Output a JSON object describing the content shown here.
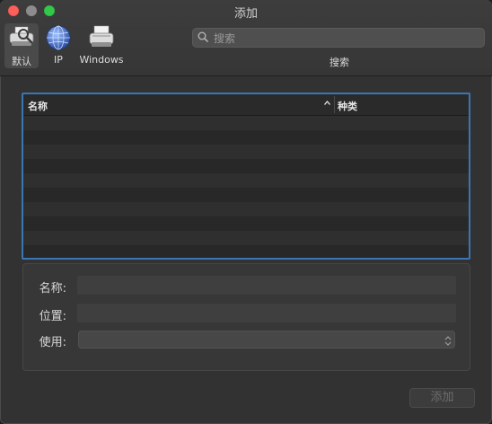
{
  "window": {
    "title": "添加"
  },
  "toolbar": {
    "items": [
      {
        "label": "默认",
        "icon": "default-printer-icon",
        "active": true
      },
      {
        "label": "IP",
        "icon": "globe-network-icon",
        "active": false
      },
      {
        "label": "Windows",
        "icon": "windows-printer-icon",
        "active": false
      }
    ],
    "search": {
      "placeholder": "搜索",
      "value": "",
      "label": "搜索"
    }
  },
  "printer_list": {
    "columns": {
      "name": "名称",
      "type": "种类"
    },
    "sort": "ascending-by-name",
    "rows": []
  },
  "details": {
    "name_label": "名称:",
    "location_label": "位置:",
    "use_label": "使用:",
    "name_value": "",
    "location_value": "",
    "use_value": ""
  },
  "actions": {
    "add_label": "添加",
    "add_enabled": false
  },
  "colors": {
    "accent": "#3b76b4",
    "close": "#fc605c",
    "maximize": "#34c84a"
  }
}
